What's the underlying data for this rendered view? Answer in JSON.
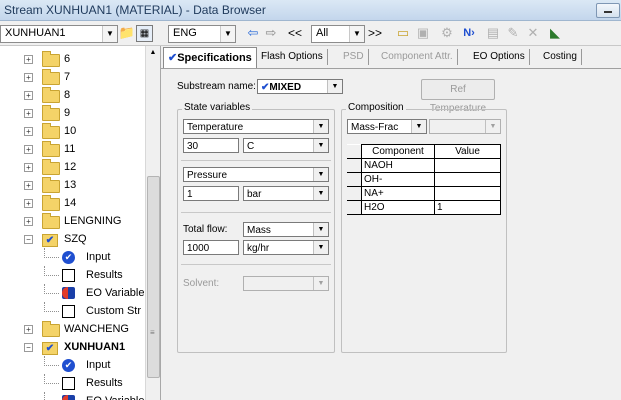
{
  "window": {
    "title": "Stream XUNHUAN1 (MATERIAL) - Data Browser"
  },
  "toolbar": {
    "stream_select": "XUNHUAN1",
    "units_select": "ENG",
    "filter_select": "All"
  },
  "tree": {
    "items": [
      {
        "label": "6",
        "type": "folder"
      },
      {
        "label": "7",
        "type": "folder"
      },
      {
        "label": "8",
        "type": "folder"
      },
      {
        "label": "9",
        "type": "folder"
      },
      {
        "label": "10",
        "type": "folder"
      },
      {
        "label": "11",
        "type": "folder"
      },
      {
        "label": "12",
        "type": "folder"
      },
      {
        "label": "13",
        "type": "folder"
      },
      {
        "label": "14",
        "type": "folder"
      },
      {
        "label": "LENGNING",
        "type": "folder"
      },
      {
        "label": "SZQ",
        "type": "folder-check"
      },
      {
        "label": "Input",
        "type": "input"
      },
      {
        "label": "Results",
        "type": "results"
      },
      {
        "label": "EO Variable",
        "type": "eo"
      },
      {
        "label": "Custom Str",
        "type": "results"
      },
      {
        "label": "WANCHENG",
        "type": "folder"
      },
      {
        "label": "XUNHUAN1",
        "type": "folder-check",
        "bold": true
      },
      {
        "label": "Input",
        "type": "input"
      },
      {
        "label": "Results",
        "type": "results"
      },
      {
        "label": "EO Variable",
        "type": "eo"
      }
    ]
  },
  "tabs": [
    {
      "label": "Specifications",
      "active": true,
      "disabled": false
    },
    {
      "label": "Flash Options",
      "active": false,
      "disabled": false
    },
    {
      "label": "PSD",
      "active": false,
      "disabled": true
    },
    {
      "label": "Component Attr.",
      "active": false,
      "disabled": true
    },
    {
      "label": "EO Options",
      "active": false,
      "disabled": false
    },
    {
      "label": "Costing",
      "active": false,
      "disabled": false
    }
  ],
  "specs": {
    "substream_label": "Substream name:",
    "substream_value": "MIXED",
    "ref_temperature_button": "Ref Temperature",
    "state_variables_title": "State variables",
    "var1_name": "Temperature",
    "var1_value": "30",
    "var1_unit": "C",
    "var2_name": "Pressure",
    "var2_value": "1",
    "var2_unit": "bar",
    "total_flow_label": "Total flow:",
    "total_flow_basis": "Mass",
    "total_flow_value": "1000",
    "total_flow_unit": "kg/hr",
    "solvent_label": "Solvent:",
    "solvent_value": ""
  },
  "composition": {
    "title": "Composition",
    "basis": "Mass-Frac",
    "secondary": "",
    "headers": {
      "component": "Component",
      "value": "Value"
    },
    "rows": [
      {
        "component": "NAOH",
        "value": ""
      },
      {
        "component": "OH-",
        "value": ""
      },
      {
        "component": "NA+",
        "value": ""
      },
      {
        "component": "H2O",
        "value": "1"
      }
    ]
  }
}
